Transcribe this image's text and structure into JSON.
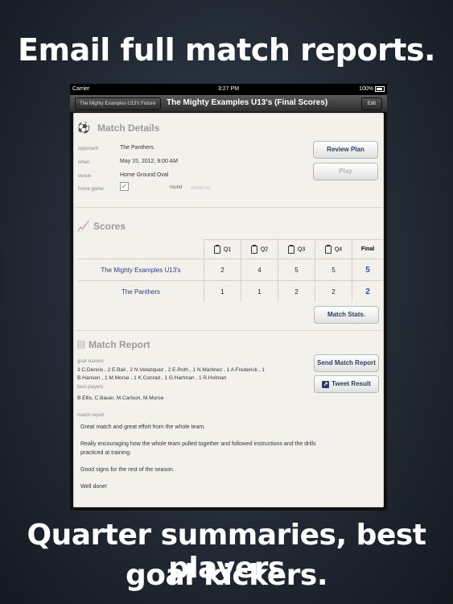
{
  "promo": {
    "headline_top": "Email full match reports.",
    "headline_bottom_1": "Quarter summaries, best players",
    "headline_bottom_2": "goal kickers."
  },
  "status_bar": {
    "carrier": "Carrier",
    "time": "3:27 PM",
    "battery": "100%"
  },
  "nav": {
    "back_label": "The Mighty Examples U13's Fixture",
    "title": "The Mighty Examples U13's (Final Scores)",
    "edit_label": "Edit"
  },
  "match_details": {
    "title": "Match Details",
    "opponent_label": "opponent",
    "opponent": "The Panthers",
    "when_label": "when",
    "when": "May 15, 2012, 9:00 AM",
    "venue_label": "venue",
    "venue": "Home Ground Oval",
    "home_game_label": "home game",
    "home_game_checked": "✓",
    "round_label": "round",
    "round_placeholder": "round no.",
    "review_plan_button": "Review Plan",
    "play_button": "Play"
  },
  "scores": {
    "title": "Scores",
    "headers": [
      "Q1",
      "Q2",
      "Q3",
      "Q4",
      "Final"
    ],
    "rows": [
      {
        "team": "The Mighty Examples U13's",
        "q": [
          "2",
          "4",
          "5",
          "5"
        ],
        "final": "5"
      },
      {
        "team": "The Panthers",
        "q": [
          "1",
          "1",
          "2",
          "2"
        ],
        "final": "2"
      }
    ],
    "match_stats_button": "Match Stats."
  },
  "match_report": {
    "title": "Match Report",
    "goal_scorers_label": "goal scorers",
    "goal_scorers_line1": "3 C.Dennis , 2 E.Bail , 2 N.Velazquez , 2 E.Roth , 1 N.Martinez , 1 A.Frederick , 1",
    "goal_scorers_line2": "B.Hansen , 1 M.Morse , 1 K.Conrad , 1 G.Hartman , 1 R.Holman",
    "best_players_label": "best players",
    "best_players": "B.Ellis, C.Bauer, M.Carlson, M.Morse",
    "report_label": "match report",
    "para1": "Great match and great effort from the whole team.",
    "para2_line1": "Really encouraging how the whole team pulled together and followed instructions and the drills",
    "para2_line2": "practiced at training.",
    "para3": "Good signs for the rest of the season.",
    "para4": "Well done!",
    "send_button": "Send Match Report",
    "tweet_button": "Tweet Result"
  }
}
